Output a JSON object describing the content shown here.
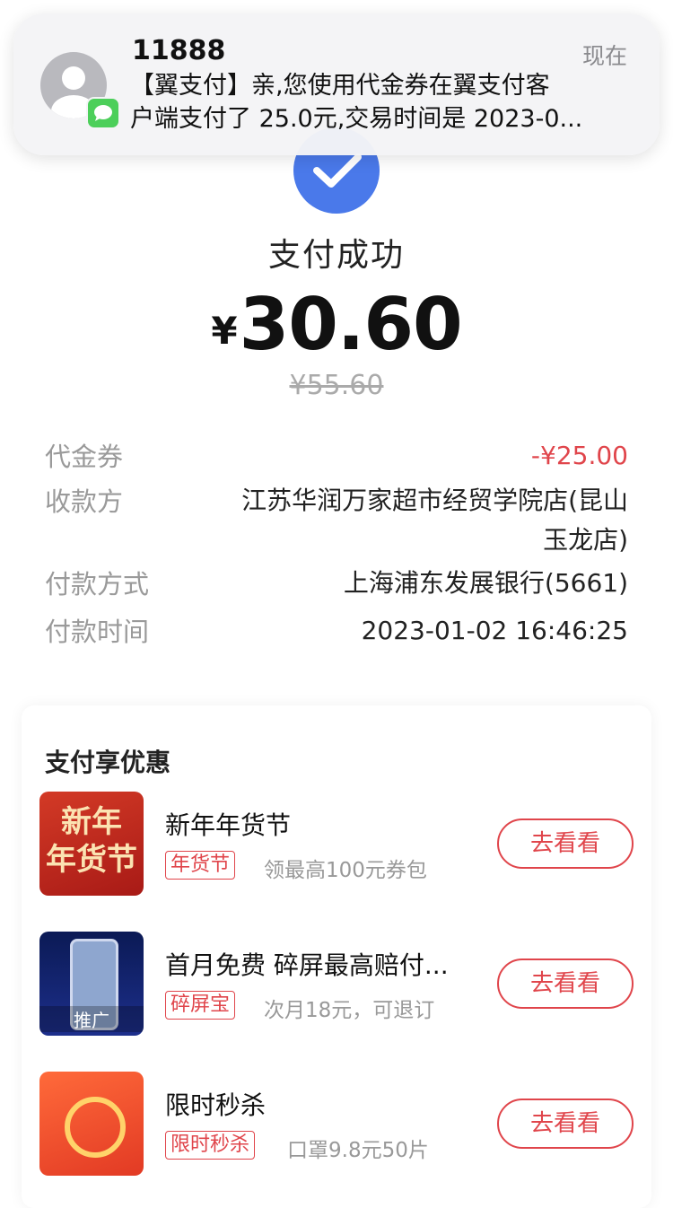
{
  "notification": {
    "sender": "11888",
    "time": "现在",
    "message_line1": "【翼支付】亲,您使用代金券在翼支付客",
    "message_line2": "户端支付了 25.0元,交易时间是 2023-0..."
  },
  "payment": {
    "status": "支付成功",
    "currency_symbol": "¥",
    "amount": "30.60",
    "original_amount": "¥55.60"
  },
  "details": {
    "voucher": {
      "label": "代金券",
      "value": "-¥25.00"
    },
    "payee": {
      "label": "收款方",
      "value_line1": "江苏华润万家超市经贸学院店(昆山",
      "value_line2": "玉龙店)"
    },
    "payment_method": {
      "label": "付款方式",
      "value": "上海浦东发展银行(5661)"
    },
    "payment_time": {
      "label": "付款时间",
      "value": "2023-01-02 16:46:25"
    }
  },
  "promotions": {
    "title": "支付享优惠",
    "items": [
      {
        "name": "新年年货节",
        "tag": "年货节",
        "desc": "领最高100元券包",
        "button": "去看看",
        "thumb_text_1": "新年",
        "thumb_text_2": "年货节"
      },
      {
        "name": "首月免费  碎屏最高赔付...",
        "tag": "碎屏宝",
        "desc": "次月18元，可退订",
        "button": "去看看",
        "thumb_label": "推广"
      },
      {
        "name": "限时秒杀",
        "tag": "限时秒杀",
        "desc": "口罩9.8元50片",
        "button": "去看看"
      }
    ]
  },
  "colors": {
    "accent_blue": "#4a79ea",
    "accent_red": "#e0454b",
    "message_badge_green": "#4ccf5a"
  }
}
